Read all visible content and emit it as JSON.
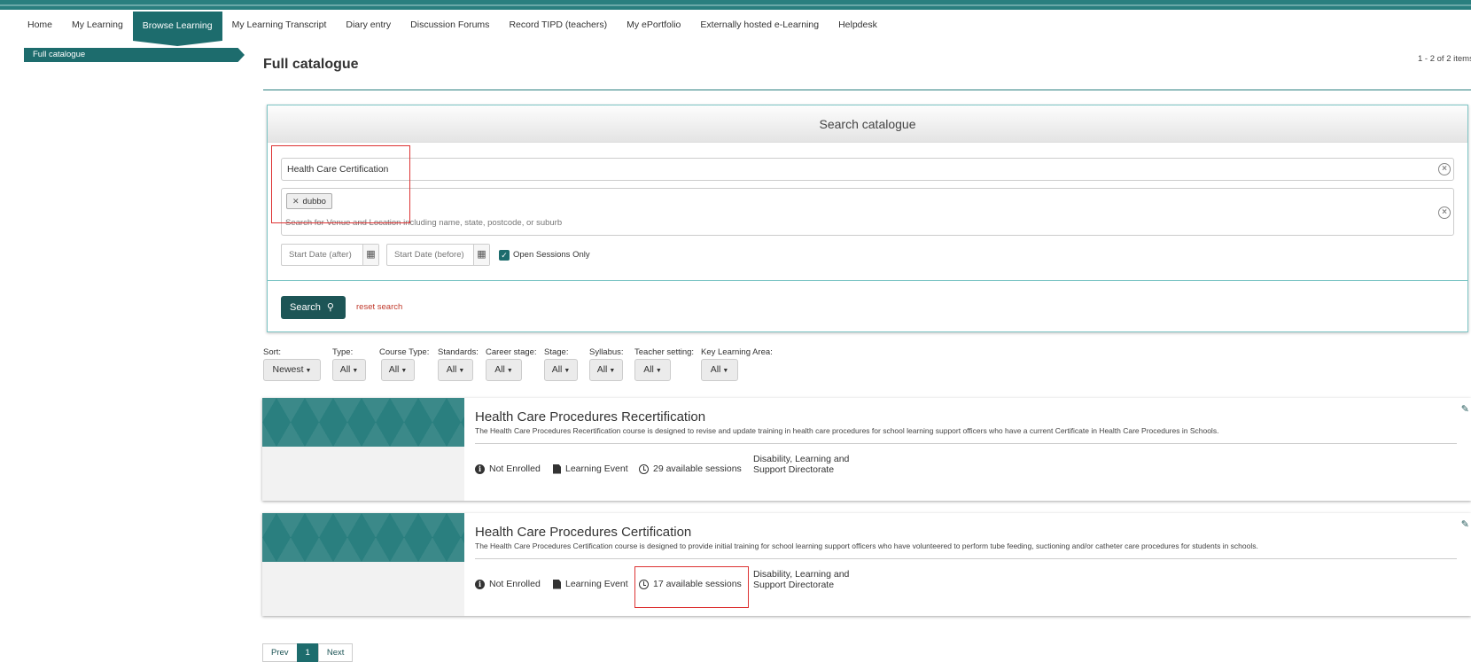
{
  "nav": {
    "items": [
      "Home",
      "My Learning",
      "Browse Learning",
      "My Learning Transcript",
      "Diary entry",
      "Discussion Forums",
      "Record TIPD (teachers)",
      "My ePortfolio",
      "Externally hosted e-Learning",
      "Helpdesk"
    ],
    "active": "Browse Learning"
  },
  "sidebar": {
    "item": "Full catalogue"
  },
  "page": {
    "title": "Full catalogue",
    "count": "1 - 2 of 2 items"
  },
  "search": {
    "header": "Search catalogue",
    "keyword_value": "Health Care Certification",
    "venue_tag": "dubbo",
    "venue_placeholder": "Search for Venue and Location including name, state, postcode, or suburb",
    "start_after_placeholder": "Start Date (after)",
    "start_before_placeholder": "Start Date (before)",
    "open_sessions_label": "Open Sessions Only",
    "open_sessions_checked": true,
    "search_button": "Search",
    "reset_link": "reset search"
  },
  "filters": [
    {
      "label": "Sort:",
      "value": "Newest"
    },
    {
      "label": "Type:",
      "value": "All"
    },
    {
      "label": "Course Type:",
      "value": "All"
    },
    {
      "label": "Standards:",
      "value": "All"
    },
    {
      "label": "Career stage:",
      "value": "All"
    },
    {
      "label": "Stage:",
      "value": "All"
    },
    {
      "label": "Syllabus:",
      "value": "All"
    },
    {
      "label": "Teacher setting:",
      "value": "All"
    },
    {
      "label": "Key Learning Area:",
      "value": "All"
    }
  ],
  "results": [
    {
      "title": "Health Care Procedures Recertification",
      "description": "The Health Care Procedures Recertification course is designed to revise and update training in health care procedures for school learning support officers who have a current Certificate in Health Care Procedures in Schools.",
      "status": "Not Enrolled",
      "type": "Learning Event",
      "sessions": "29 available sessions",
      "directorate": "Disability, Learning and\nSupport Directorate"
    },
    {
      "title": "Health Care Procedures Certification",
      "description": "The Health Care Procedures Certification course is designed to provide initial training for school learning support officers who have volunteered to perform tube feeding, suctioning and/or catheter care procedures for students in schools.",
      "status": "Not Enrolled",
      "type": "Learning Event",
      "sessions": "17 available sessions",
      "directorate": "Disability, Learning and\nSupport Directorate"
    }
  ],
  "pager": {
    "prev": "Prev",
    "current": "1",
    "next": "Next"
  },
  "colors": {
    "brand": "#1d6c6d",
    "dark_brand": "#1d5556",
    "highlight_box": "#dd3333"
  }
}
